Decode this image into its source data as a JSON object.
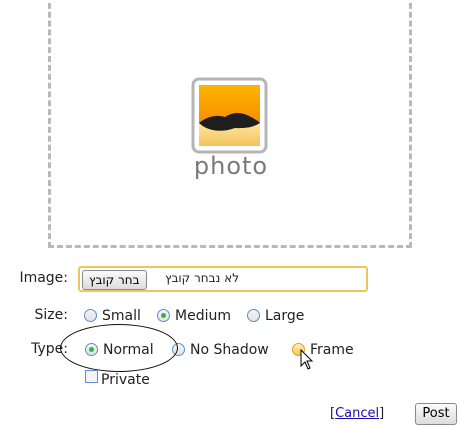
{
  "placeholder": {
    "caption": "photo",
    "icon": "photo-icon"
  },
  "image_field": {
    "label": "Image:",
    "button_label": "בחר קובץ",
    "status_text": "לא נבחר קובץ"
  },
  "size_field": {
    "label": "Size:",
    "options": [
      {
        "label": "Small",
        "checked": false
      },
      {
        "label": "Medium",
        "checked": true
      },
      {
        "label": "Large",
        "checked": false
      }
    ]
  },
  "type_field": {
    "label": "Type:",
    "options": [
      {
        "label": "Normal",
        "checked": true
      },
      {
        "label": "No Shadow",
        "checked": false
      },
      {
        "label": "Frame",
        "checked": false
      }
    ]
  },
  "private_field": {
    "label": "Private",
    "checked": false
  },
  "actions": {
    "cancel_open": "[",
    "cancel_label": "Cancel",
    "cancel_close": "]",
    "post_label": "Post"
  },
  "colors": {
    "dashed_border": "#b9b9b9",
    "input_focus_border": "#f0c65a",
    "radio_checked": "#2fb34a",
    "link": "#1a0dab"
  }
}
